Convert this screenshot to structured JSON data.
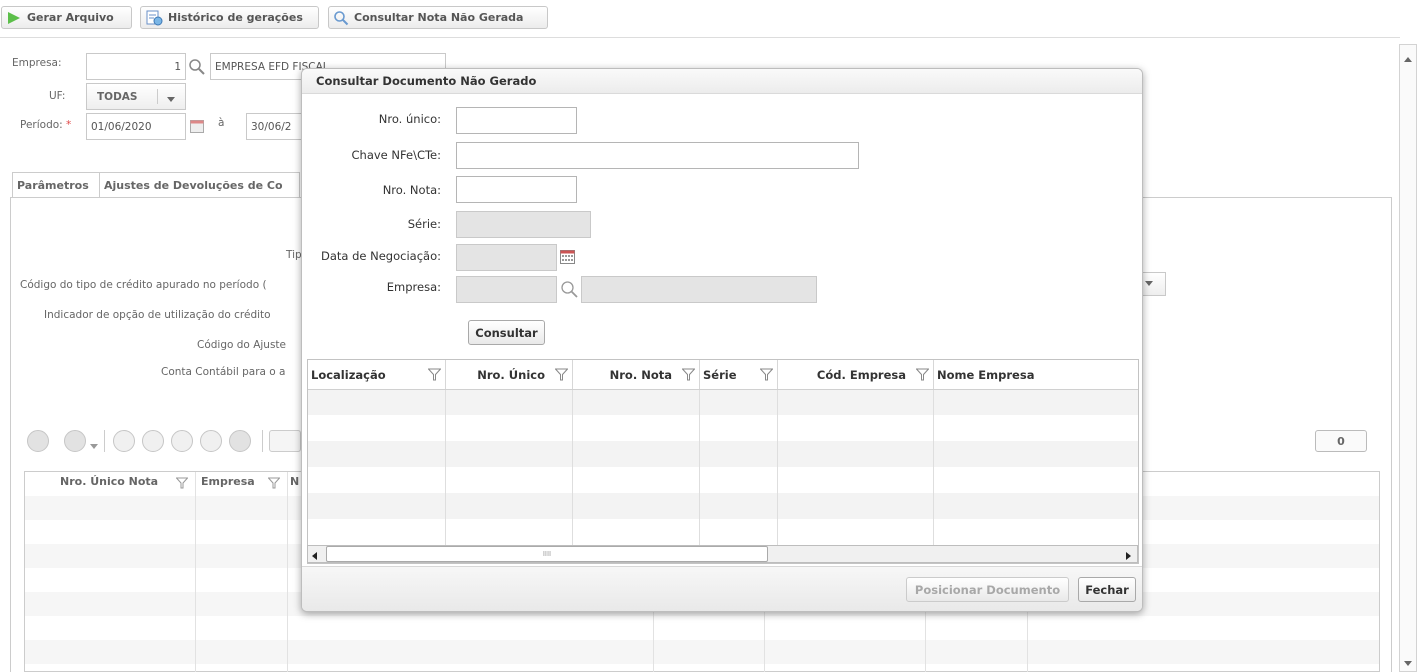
{
  "toolbar": {
    "gerar_label": "Gerar Arquivo",
    "historico_label": "Histórico de gerações",
    "consultar_label": "Consultar Nota Não Gerada"
  },
  "form": {
    "empresa_label": "Empresa:",
    "empresa_code": "1",
    "empresa_name": "EMPRESA EFD FISCAL",
    "uf_label": "UF:",
    "uf_value": "TODAS",
    "periodo_label": "Período:",
    "periodo_req": "*",
    "periodo_start": "01/06/2020",
    "periodo_sep": "à",
    "periodo_end": "30/06/2"
  },
  "tabs": {
    "parametros": "Parâmetros",
    "ajustes": "Ajustes de Devoluções de Co"
  },
  "panel": {
    "tipo_label": "Tip",
    "codigo_tipo_label": "Código do tipo de crédito apurado no período (",
    "indicador_label": "Indicador de opção de utilização do crédito",
    "codigo_ajuste_label": "Código do Ajuste",
    "conta_label": "Conta Contábil para o a",
    "count_badge": "0"
  },
  "bg_grid": {
    "col1": "Nro. Único Nota",
    "col2": "Empresa",
    "col3": "N"
  },
  "modal": {
    "title": "Consultar Documento Não Gerado",
    "fields": {
      "nro_unico_label": "Nro. único:",
      "chave_label": "Chave NFe\\CTe:",
      "nro_nota_label": "Nro. Nota:",
      "serie_label": "Série:",
      "data_label": "Data de Negociação:",
      "empresa_label": "Empresa:"
    },
    "consultar_label": "Consultar",
    "grid_columns": [
      "Localização",
      "Nro. Único",
      "Nro. Nota",
      "Série",
      "Cód. Empresa",
      "Nome Empresa"
    ],
    "scroll_grip": "IIII",
    "posicionar_label": "Posicionar Documento",
    "fechar_label": "Fechar"
  },
  "colors": {
    "accent_green": "#43a047",
    "required_red": "#e04848",
    "disabled_field": "#e4e4e4"
  }
}
